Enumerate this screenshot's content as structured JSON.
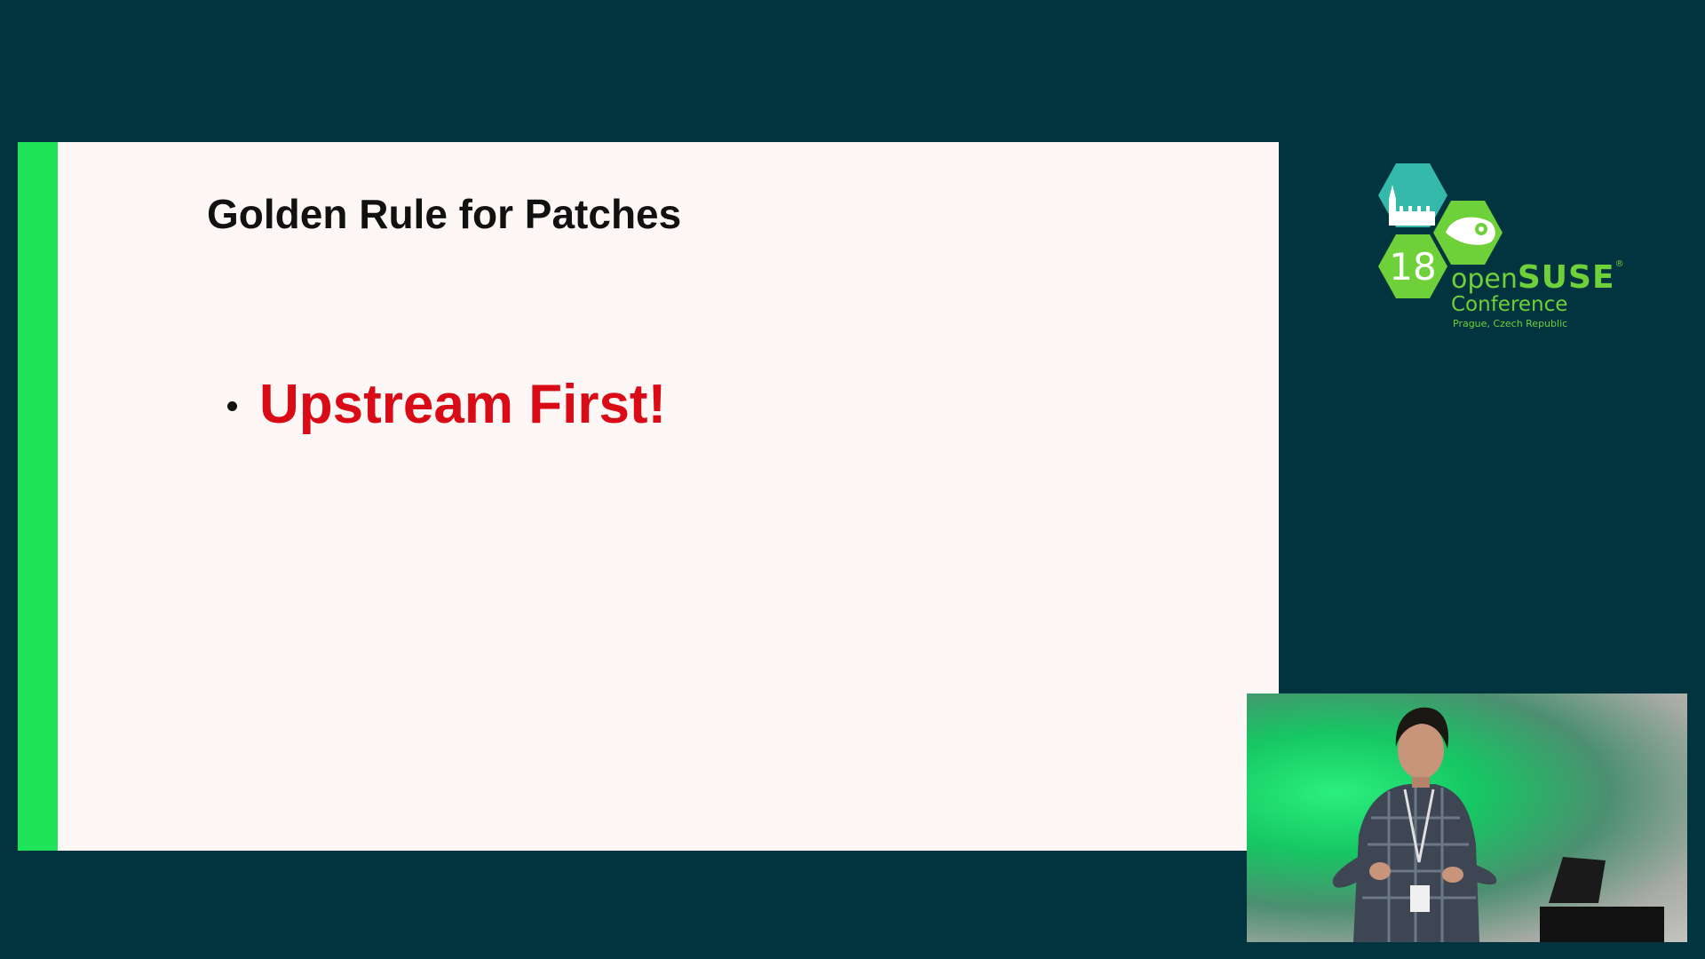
{
  "slide": {
    "title": "Golden Rule for Patches",
    "bullets": [
      {
        "text": "Upstream First!",
        "color": "#d80b16"
      }
    ],
    "accent_color": "#1ee45a",
    "background_color": "#fdf8f6"
  },
  "logo": {
    "edition": "18",
    "brand_open": "open",
    "brand_suse": "SUSE",
    "registered_mark": "®",
    "subtitle": "Conference",
    "location": "Prague, Czech Republic",
    "brand_color": "#6fd13a"
  },
  "video": {
    "icon": "speaker-video-feed"
  },
  "colors": {
    "page_background": "#023440"
  }
}
